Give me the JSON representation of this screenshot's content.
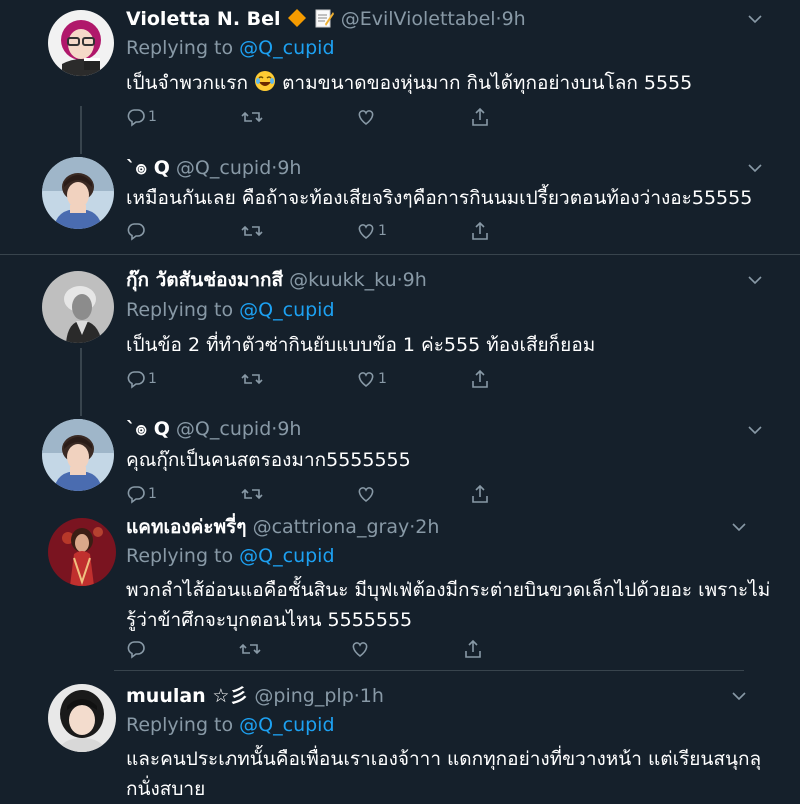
{
  "tweets": [
    {
      "name": "Violetta N. Bel",
      "handle": "@EvilViolettabel",
      "time": "9h",
      "replying_label": "Replying to",
      "replying_to": "@Q_cupid",
      "text_before_emoji": "เป็นจำพวกแรก",
      "text_after_emoji": "ตามขนาดของหุ่นมาก กินได้ทุกอย่างบนโลก 5555",
      "reply_count": "1",
      "like_count": ""
    },
    {
      "name": "`๏ Q",
      "handle": "@Q_cupid",
      "time": "9h",
      "text": "เหมือนกันเลย คือถ้าจะท้องเสียจริงๆคือการกินนมเปรี้ยวตอนท้องว่างอะ55555",
      "reply_count": "",
      "like_count": "1"
    },
    {
      "name": "กุ๊ก วัตสันช่องมากสี",
      "handle": "@kuukk_ku",
      "time": "9h",
      "replying_label": "Replying to",
      "replying_to": "@Q_cupid",
      "text": "เป็นข้อ 2 ที่ทำตัวซ่ากินยับแบบข้อ 1 ค่ะ555 ท้องเสียก็ยอม",
      "reply_count": "1",
      "like_count": "1"
    },
    {
      "name": "`๏ Q",
      "handle": "@Q_cupid",
      "time": "9h",
      "text": "คุณกุ๊กเป็นคนสตรองมาก5555555",
      "reply_count": "1",
      "like_count": ""
    },
    {
      "name": "แคทเองค่ะพรี่ๆ",
      "handle": "@cattriona_gray",
      "time": "2h",
      "replying_label": "Replying to",
      "replying_to": "@Q_cupid",
      "text_line1": "พวกลำไส้อ่อนแอคือชั้นสินะ มีบุฟเฟ่ต้องมีกระต่ายบินขวดเล็กไปด้วยอะ เพราะไม่",
      "text_line2": "รู้ว่าข้าศึกจะบุกตอนไหน 5555555",
      "reply_count": "",
      "like_count": ""
    },
    {
      "name": "muulan ☆彡",
      "handle": "@ping_plp",
      "time": "1h",
      "replying_label": "Replying to",
      "replying_to": "@Q_cupid",
      "text_line1": "และคนประเภทนั้นคือเพื่อนเราเองจ้าาา แดกทุกอย่างที่ขวางหน้า แต่เรียนสนุกลุ",
      "text_line2": "กนั่งสบาย"
    }
  ],
  "dot": "·",
  "colors": {
    "background": "#15202b",
    "secondary": "#8899a6",
    "accent": "#1da1f2",
    "divider": "#38444d"
  },
  "icons": [
    "reply-icon",
    "retweet-icon",
    "like-icon",
    "share-icon",
    "chevron-down-icon",
    "diamond-icon",
    "memo-icon",
    "laughing-emoji-icon"
  ]
}
